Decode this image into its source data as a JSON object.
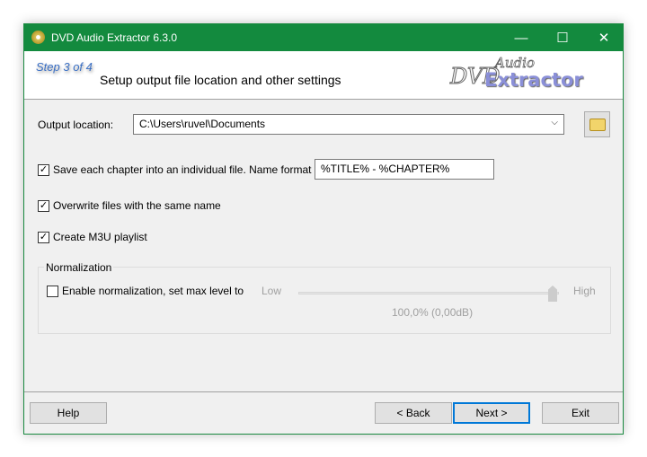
{
  "window": {
    "title": "DVD Audio Extractor 6.3.0",
    "minimize": "—",
    "maximize": "☐",
    "close": "✕"
  },
  "header": {
    "step": "Step 3 of 4",
    "title": "Setup output file location and other settings",
    "logo": {
      "dvd": "DVD",
      "audio": "Audio",
      "extractor": "Extractor"
    }
  },
  "output": {
    "label": "Output location:",
    "value": "C:\\Users\\ruvel\\Documents",
    "arrow": "⌵"
  },
  "options": {
    "save_chapters": {
      "label": "Save each chapter into an individual file. Name format",
      "checked": true,
      "format": "%TITLE% - %CHAPTER%"
    },
    "overwrite": {
      "label": "Overwrite files with the same name",
      "checked": true
    },
    "m3u": {
      "label": "Create M3U playlist",
      "checked": true
    }
  },
  "normalization": {
    "group": "Normalization",
    "enable_label": "Enable normalization, set max level to",
    "checked": false,
    "low": "Low",
    "high": "High",
    "level_percent": 100,
    "value_text": "100,0% (0,00dB)"
  },
  "buttons": {
    "help": "Help",
    "back": "< Back",
    "next": "Next >",
    "exit": "Exit"
  },
  "check_glyph": "✓"
}
